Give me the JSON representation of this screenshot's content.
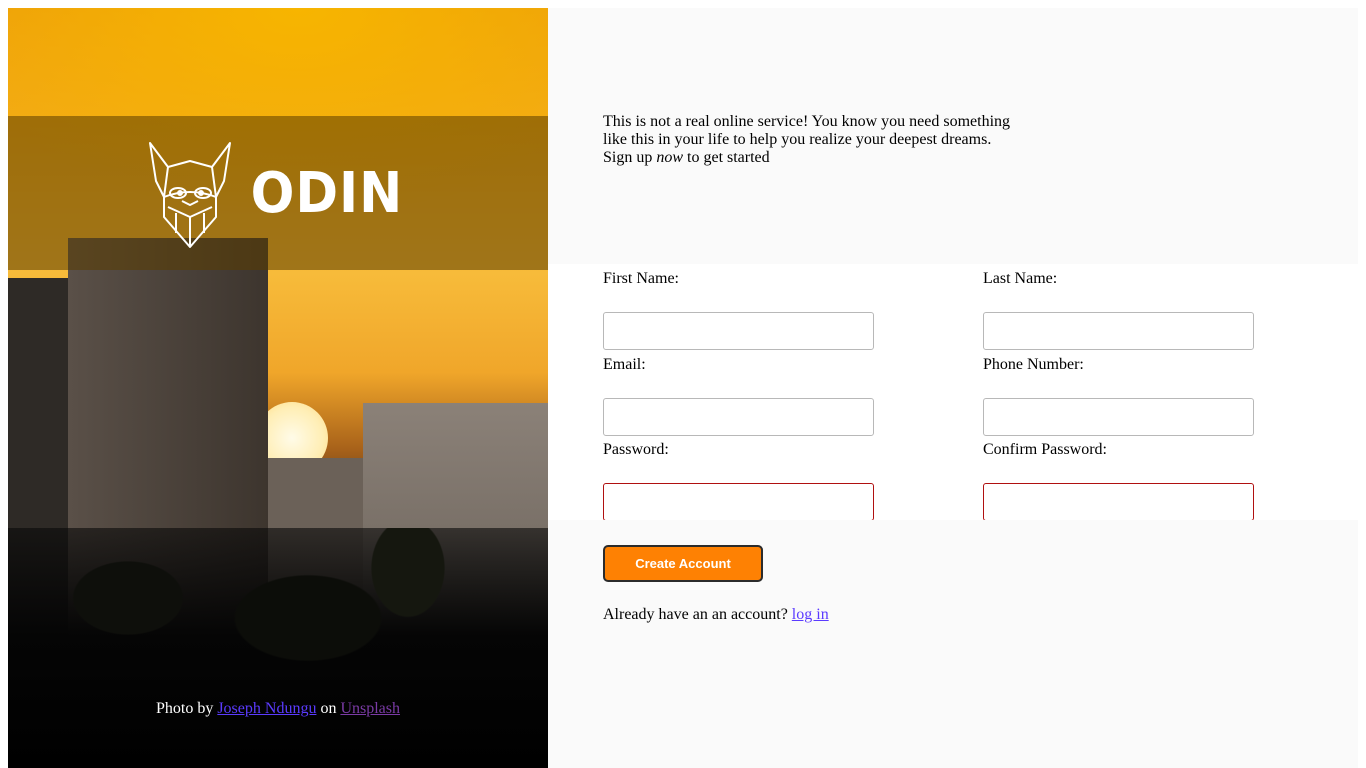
{
  "brand": {
    "logo_text": "ODIN"
  },
  "credit": {
    "prefix": "Photo by",
    "photographer": "Joseph Ndungu",
    "middle": "on",
    "site": "Unsplash"
  },
  "intro": {
    "line1": "This is not a real online service! You know you need something like this in your life to help you realize your deepest dreams.",
    "line2_before": "Sign up",
    "line2_emphasis": "now",
    "line2_after": "to get started"
  },
  "form": {
    "first_name_label": "First Name:",
    "first_name_value": "",
    "last_name_label": "Last Name:",
    "last_name_value": "",
    "email_label": "Email:",
    "email_value": "",
    "phone_label": "Phone Number:",
    "phone_value": "",
    "password_label": "Password:",
    "password_value": "",
    "confirm_password_label": "Confirm Password:",
    "confirm_password_value": ""
  },
  "actions": {
    "create_account_label": "Create Account",
    "login_prompt": "Already have an an account?",
    "login_link": "log in"
  },
  "colors": {
    "accent_button": "#fe8103",
    "invalid_border": "#b01010",
    "link": "#5b3bff"
  }
}
